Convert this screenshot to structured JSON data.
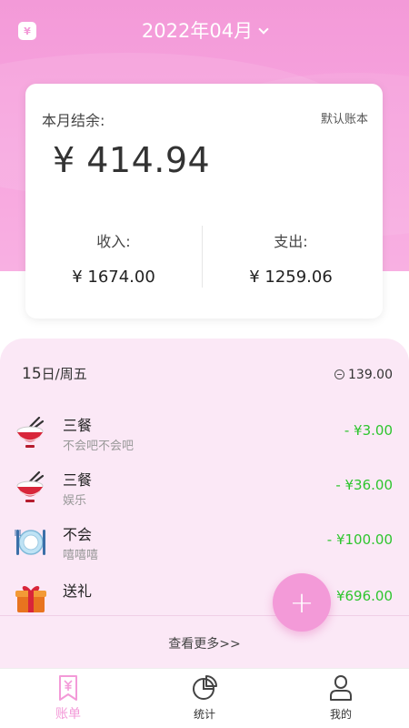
{
  "header": {
    "app_icon_glyph": "¥",
    "month_label": "2022年04月",
    "accent_color": "#f39ad8"
  },
  "summary": {
    "balance_label": "本月结余:",
    "ledger_name": "默认账本",
    "balance_amount": "¥ 414.94",
    "income_label": "收入:",
    "income_amount": "¥ 1674.00",
    "expense_label": "支出:",
    "expense_amount": "¥ 1259.06"
  },
  "day_group": {
    "day": "15",
    "weekday": "日/周五",
    "total": "139.00"
  },
  "transactions": [
    {
      "category": "三餐",
      "note": "不会吧不会吧",
      "amount": "- ¥3.00",
      "icon": "rice-bowl-icon"
    },
    {
      "category": "三餐",
      "note": "娱乐",
      "amount": "- ¥36.00",
      "icon": "rice-bowl-icon"
    },
    {
      "category": "不会",
      "note": "嘻嘻嘻",
      "amount": "- ¥100.00",
      "icon": "dining-plate-icon"
    },
    {
      "category": "送礼",
      "note": "",
      "amount": "¥696.00",
      "icon": "gift-icon"
    }
  ],
  "more_link": "查看更多>>",
  "fab_label": "+",
  "bottom_nav": [
    {
      "label": "账单",
      "icon": "bill-icon",
      "active": true
    },
    {
      "label": "统计",
      "icon": "pie-chart-icon",
      "active": false
    },
    {
      "label": "我的",
      "icon": "user-icon",
      "active": false
    }
  ],
  "colors": {
    "income_green": "#2ec52e",
    "panel_pink": "#fbe8f6"
  }
}
